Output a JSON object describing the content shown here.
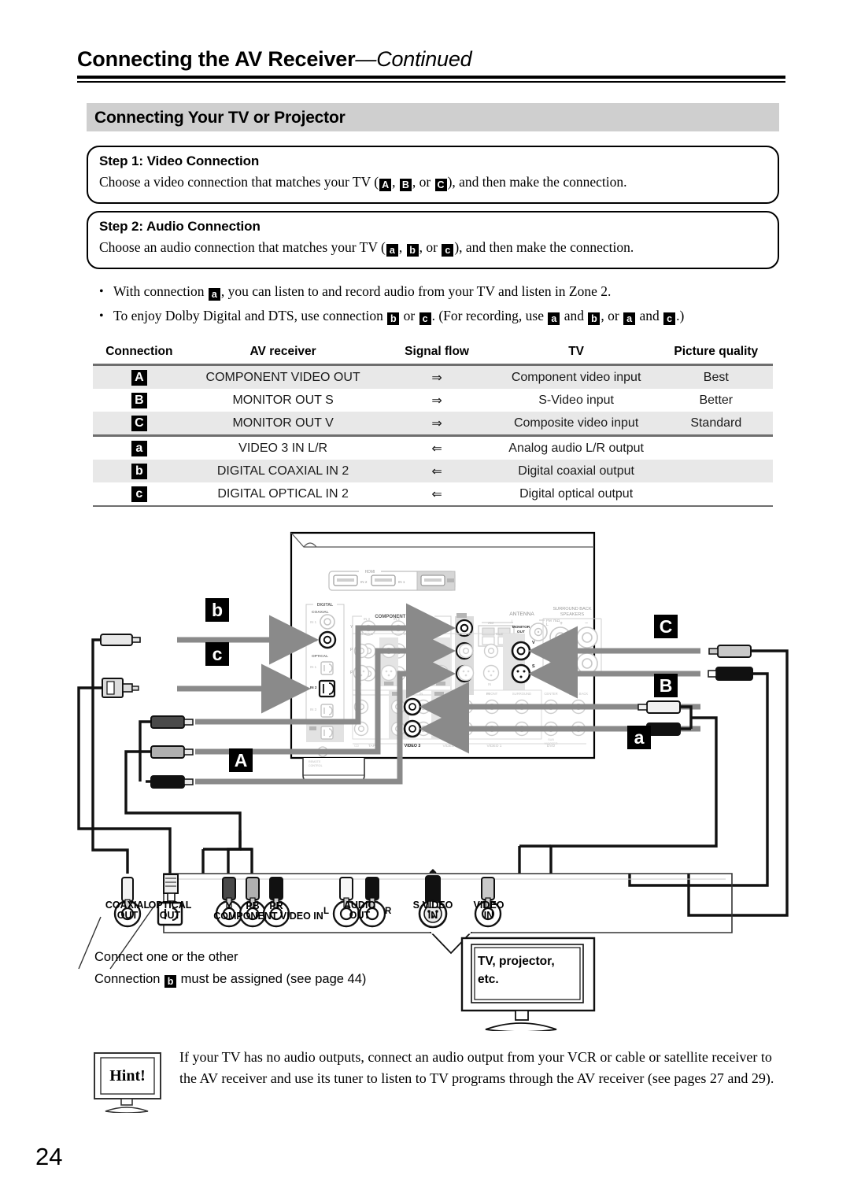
{
  "header": {
    "title_main": "Connecting the AV Receiver",
    "title_cont": "—Continued"
  },
  "section": {
    "title": "Connecting Your TV or Projector"
  },
  "steps": [
    {
      "title": "Step 1: Video Connection",
      "text_before": "Choose a video connection that matches your TV (",
      "key1": "A",
      "sep1": ", ",
      "key2": "B",
      "sep2": ", or ",
      "key3": "C",
      "text_after": "), and then make the connection."
    },
    {
      "title": "Step 2: Audio Connection",
      "text_before": "Choose an audio connection that matches your TV (",
      "key1": "a",
      "sep1": ", ",
      "key2": "b",
      "sep2": ", or ",
      "key3": "c",
      "text_after": "), and then make the connection."
    }
  ],
  "bullets": [
    {
      "p1": "With connection ",
      "k1": "a",
      "p2": ", you can listen to and record audio from your TV and listen in Zone 2."
    },
    {
      "p1": "To enjoy Dolby Digital and DTS, use connection ",
      "k1": "b",
      "p2": " or ",
      "k2": "c",
      "p3": ". (For recording, use ",
      "k3": "a",
      "p4": " and ",
      "k4": "b",
      "p5": ", or ",
      "k5": "a",
      "p6": " and ",
      "k6": "c",
      "p7": ".)"
    }
  ],
  "table": {
    "headers": [
      "Connection",
      "AV receiver",
      "Signal flow",
      "TV",
      "Picture quality"
    ],
    "rows": [
      {
        "connection": "A",
        "av_receiver": "COMPONENT VIDEO OUT",
        "flow": "⇒",
        "tv": "Component video input",
        "quality": "Best"
      },
      {
        "connection": "B",
        "av_receiver": "MONITOR OUT S",
        "flow": "⇒",
        "tv": "S-Video input",
        "quality": "Better"
      },
      {
        "connection": "C",
        "av_receiver": "MONITOR OUT V",
        "flow": "⇒",
        "tv": "Composite video input",
        "quality": "Standard"
      },
      {
        "connection": "a",
        "av_receiver": "VIDEO 3 IN L/R",
        "flow": "⇐",
        "tv": "Analog audio L/R output",
        "quality": ""
      },
      {
        "connection": "b",
        "av_receiver": "DIGITAL COAXIAL IN 2",
        "flow": "⇐",
        "tv": "Digital coaxial output",
        "quality": ""
      },
      {
        "connection": "c",
        "av_receiver": "DIGITAL OPTICAL IN 2",
        "flow": "⇐",
        "tv": "Digital optical output",
        "quality": ""
      }
    ]
  },
  "diagram": {
    "badges": {
      "b": "b",
      "c": "c",
      "A": "A",
      "C": "C",
      "B": "B",
      "a": "a"
    },
    "receiver_panel": {
      "hdmi_group": "HDMI",
      "hdmi_ports": [
        "IN 2",
        "IN 1",
        "OUT"
      ],
      "digital_group": "DIGITAL",
      "coaxial_label": "COAXIAL",
      "coaxial_jacks": [
        "IN 1",
        "IN 2"
      ],
      "optical_label": "OPTICAL",
      "optical_jacks": [
        "IN 1",
        "IN 2",
        "IN 3",
        "OUT"
      ],
      "component_video_label": "COMPONENT VIDEO",
      "component_rows": [
        "Y",
        "PB",
        "PR"
      ],
      "component_inputs": [
        "IN 3",
        "IN 2",
        "IN 1"
      ],
      "component_out": "OUT",
      "antenna_label": "ANTENNA",
      "antenna_am": "AM",
      "antenna_fm": "FM 75Ω",
      "surround_back_label": "SURROUND BACK SPEAKERS",
      "speaker_lr": [
        "L",
        "R"
      ],
      "speaker_pm": [
        "+",
        "−"
      ],
      "monitor_out_label": "MONITOR OUT",
      "monitor_out_v": "V",
      "monitor_out_s": "S",
      "source_groups_top": [
        "VIDEO 3",
        "VIDEO 2",
        "VIDEO 1",
        "DVD"
      ],
      "source_groups_bottom": [
        "TAPE",
        "VIDEO 3",
        "VIDEO 2",
        "VIDEO 1",
        "DVD"
      ],
      "preout_labels": [
        "FRONT",
        "SURROUND",
        "CENTER",
        "SURR BACK",
        "SUB WOOFER"
      ],
      "in_out_labels": [
        "IN",
        "OUT"
      ],
      "remote_control": "REMOTE CONTROL",
      "ir_label": "IR 1"
    },
    "tv_panel": {
      "jacks": [
        {
          "label_top": "COAXIAL",
          "label_bot": "OUT"
        },
        {
          "label_top": "OPTICAL",
          "label_bot": "OUT"
        },
        {
          "label_top": "Y",
          "label_bot": ""
        },
        {
          "label_top": "PB",
          "label_bot": ""
        },
        {
          "label_top": "PR",
          "label_bot": ""
        },
        {
          "label_top": "AUDIO",
          "label_bot": "OUT"
        },
        {
          "label_top": "S VIDEO",
          "label_bot": "IN"
        },
        {
          "label_top": "VIDEO",
          "label_bot": "IN"
        }
      ],
      "component_caption": "COMPONENT VIDEO IN",
      "audio_l": "L",
      "audio_r": "R"
    },
    "tv_screen_text_l1": "TV, projector,",
    "tv_screen_text_l2": "etc."
  },
  "notes": {
    "line1": "Connect one or the other",
    "line2_p1": "Connection ",
    "line2_key": "b",
    "line2_p2": " must be assigned (see page 44)"
  },
  "hint": {
    "label": "Hint!",
    "text": "If your TV has no audio outputs, connect an audio output from your VCR or cable or satellite receiver to the AV receiver and use its tuner to listen to TV programs through the AV receiver (see pages 27 and 29)."
  },
  "page_number": "24",
  "colors": {
    "shade_row": "#e8e8e8",
    "section_bar": "#cfcfcf",
    "rule": "#6e6e6e",
    "arrow_gray": "#8a8a8a"
  }
}
